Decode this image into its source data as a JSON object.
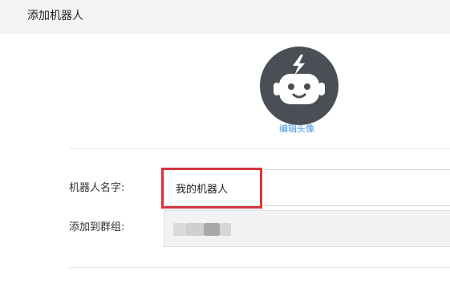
{
  "dialog": {
    "title": "添加机器人"
  },
  "avatar": {
    "icon": "robot-avatar-icon",
    "edit_label": "编辑头像"
  },
  "form": {
    "name_label": "机器人名字:",
    "name_value": "我的机器人",
    "group_label": "添加到群组:",
    "group_value_redacted": true
  },
  "colors": {
    "accent_link": "#3f96e6",
    "highlight": "#d8343f",
    "avatar_bg": "#4a4e55"
  }
}
